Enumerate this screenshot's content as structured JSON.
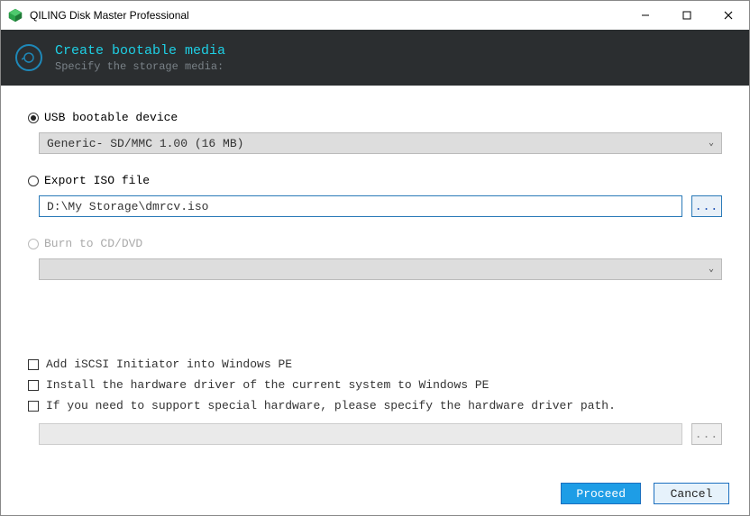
{
  "window": {
    "title": "QILING Disk Master Professional"
  },
  "header": {
    "heading": "Create bootable media",
    "subheading": "Specify the storage media:"
  },
  "options": {
    "usb": {
      "label": "USB bootable device",
      "selected": true,
      "device": "Generic- SD/MMC 1.00 (16 MB)"
    },
    "iso": {
      "label": "Export ISO file",
      "selected": false,
      "path": "D:\\My Storage\\dmrcv.iso"
    },
    "cd": {
      "label": "Burn to CD/DVD",
      "selected": false,
      "disabled": true
    }
  },
  "checks": {
    "iscsi": "Add iSCSI Initiator into Windows PE",
    "driver_current": "Install the hardware driver of the current system to Windows PE",
    "driver_path": "If you need to support special hardware, please specify the hardware driver path."
  },
  "browse_label": "...",
  "buttons": {
    "proceed": "Proceed",
    "cancel": "Cancel"
  }
}
